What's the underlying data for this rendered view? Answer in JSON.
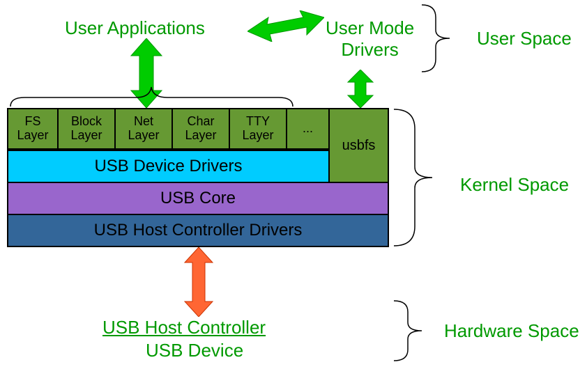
{
  "labels": {
    "user_applications": "User Applications",
    "user_mode_drivers_l1": "User Mode",
    "user_mode_drivers_l2": "Drivers",
    "user_space": "User Space",
    "kernel_space": "Kernel Space",
    "hardware_space": "Hardware Space",
    "usb_host_controller": "USB Host Controller",
    "usb_device": "USB Device"
  },
  "kernel_layers": {
    "sublayers": [
      {
        "l1": "FS",
        "l2": "Layer"
      },
      {
        "l1": "Block",
        "l2": "Layer"
      },
      {
        "l1": "Net",
        "l2": "Layer"
      },
      {
        "l1": "Char",
        "l2": "Layer"
      },
      {
        "l1": "TTY",
        "l2": "Layer"
      }
    ],
    "ellipsis": "...",
    "usbfs": "usbfs",
    "usb_device_drivers": "USB Device Drivers",
    "usb_core": "USB Core",
    "usb_hcd": "USB Host Controller Drivers"
  }
}
